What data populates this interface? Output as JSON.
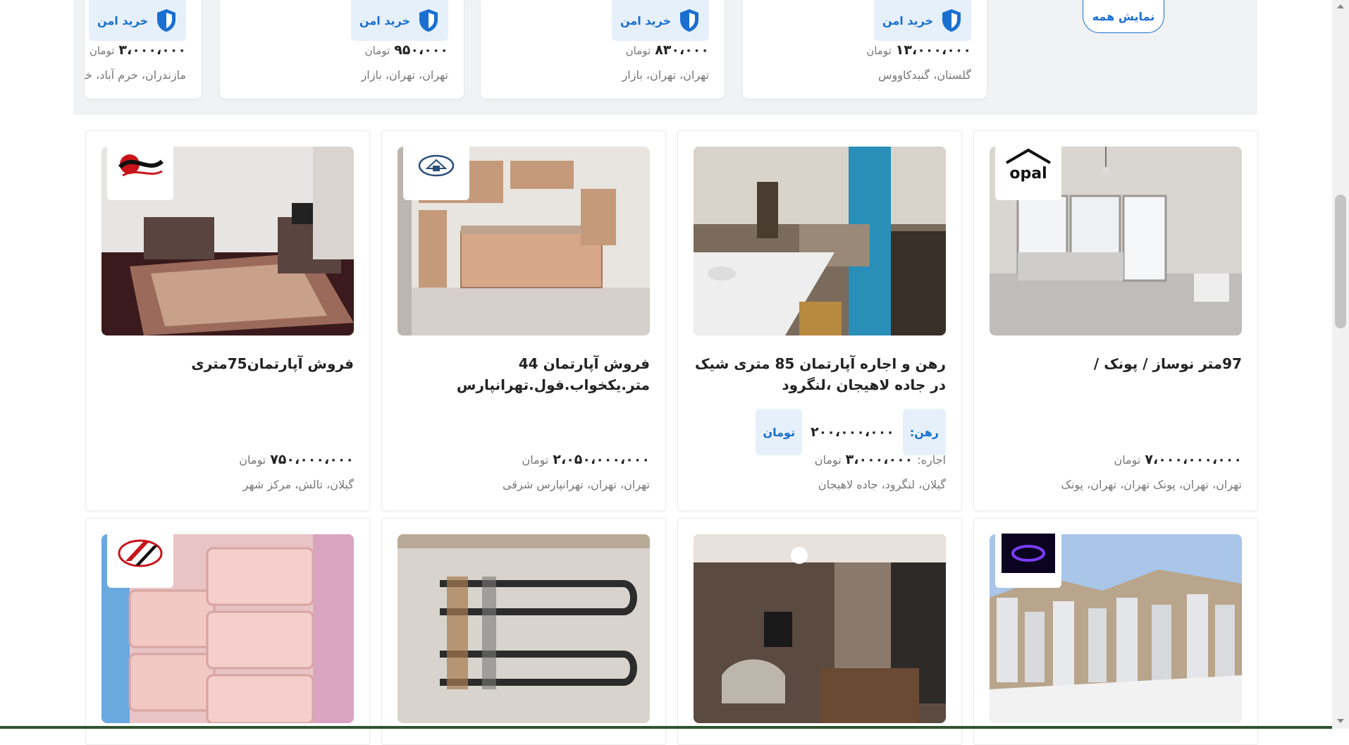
{
  "top_row": {
    "show_all_label": "نمایش همه",
    "cards": [
      {
        "secure_label": "خرید امن",
        "price": "۱۳،۰۰۰،۰۰۰",
        "unit": "تومان",
        "location": "گلستان، گنبدکاووس"
      },
      {
        "secure_label": "خرید امن",
        "price": "۸۳۰،۰۰۰",
        "unit": "تومان",
        "location": "تهران، تهران، بازار"
      },
      {
        "secure_label": "خرید امن",
        "price": "۹۵۰،۰۰۰",
        "unit": "تومان",
        "location": "تهران، تهران، بازار"
      },
      {
        "secure_label": "خرید امن",
        "price": "۳،۰۰۰،۰۰۰",
        "unit": "تومان",
        "location": "مازندران، خرم آباد، خر"
      }
    ]
  },
  "listings": [
    {
      "title": "97متر نوساز / پونک /",
      "price": "۷،۰۰۰،۰۰۰،۰۰۰",
      "unit": "تومان",
      "location": "تهران، تهران، پونک تهران، تهران، پونک",
      "logo_text": "opal",
      "image": "apartment-interior"
    },
    {
      "title": "رهن و اجاره آپارتمان 85 متری شیک در جاده لاهیجان ،لنگرود",
      "deposit_label": "رهن:",
      "deposit_value": "۲۰۰،۰۰۰،۰۰۰",
      "deposit_unit": "تومان",
      "rent_label": "اجاره:",
      "price": "۳،۰۰۰،۰۰۰",
      "unit": "تومان",
      "location": "گیلان، لنگرود، جاده لاهیجان",
      "image": "living-room"
    },
    {
      "title": "فروش آپارتمان 44 متر.یکخواب.فول.تهرانپارس",
      "price": "۲،۰۵۰،۰۰۰،۰۰۰",
      "unit": "تومان",
      "location": "تهران، تهران، تهرانپارس شرقی",
      "image": "kitchen"
    },
    {
      "title": "فروش آپارتمان75متری",
      "price": "۷۵۰،۰۰۰،۰۰۰",
      "unit": "تومان",
      "location": "گیلان، تالش، مرکز شهر",
      "image": "carpet-room"
    }
  ],
  "second_row": [
    {
      "image": "city-towers"
    },
    {
      "image": "modern-living"
    },
    {
      "image": "heating-elements"
    },
    {
      "image": "plastic-containers"
    }
  ],
  "colors": {
    "accent": "#1a6fd1",
    "badge_bg": "#e6f0fb",
    "band_bg": "#f1f2f4"
  }
}
